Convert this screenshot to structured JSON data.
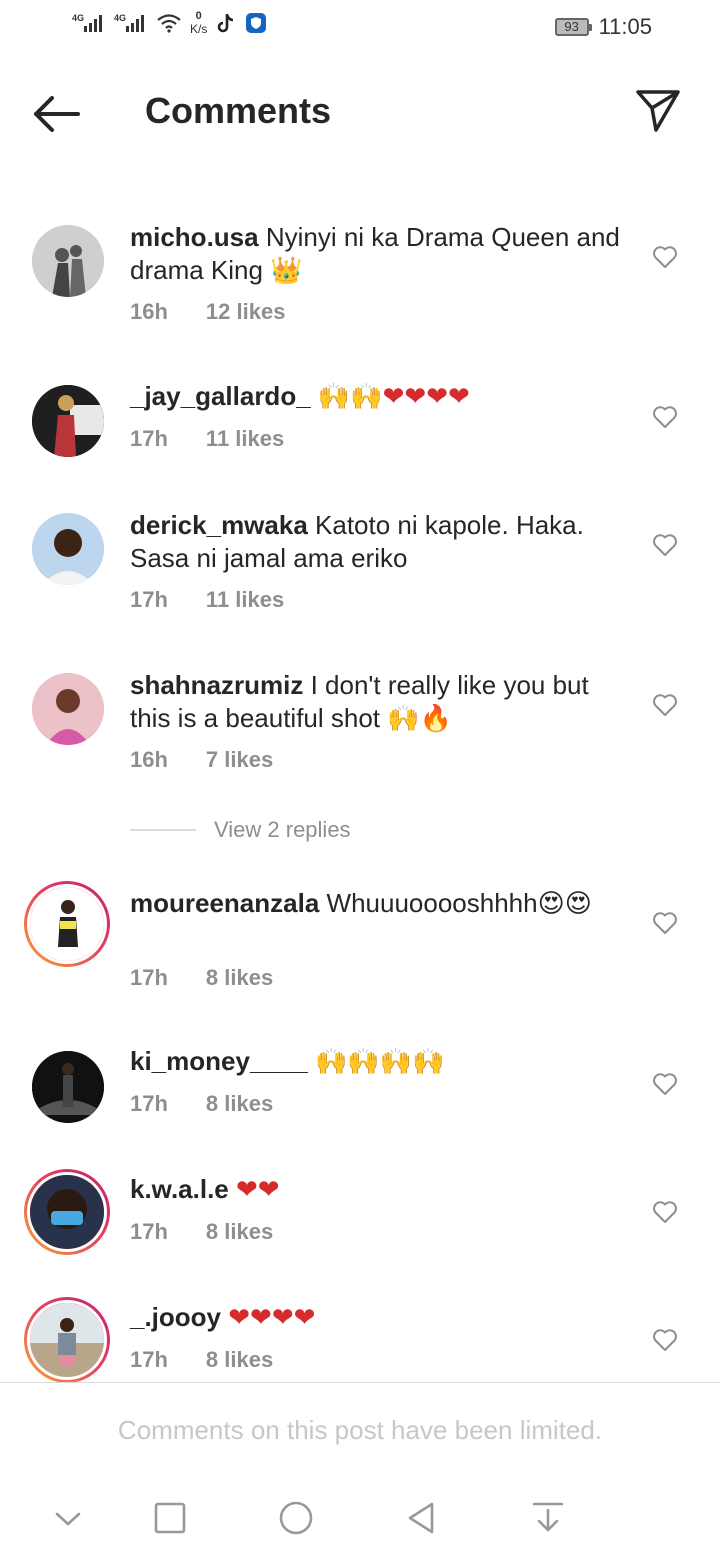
{
  "status_bar": {
    "net1": "4G",
    "net2": "4G",
    "speed_value": "0",
    "speed_unit": "K/s",
    "battery": "93",
    "time": "11:05"
  },
  "header": {
    "title": "Comments"
  },
  "comments": [
    {
      "user": "micho.usa",
      "text": "Nyinyi ni ka Drama Queen and drama King 👑",
      "time": "16h",
      "likes": "12 likes"
    },
    {
      "user": "_jay_gallardo_",
      "text": "🙌🙌❤❤❤❤",
      "time": "17h",
      "likes": "11 likes"
    },
    {
      "user": "derick_mwaka",
      "text": "Katoto ni kapole.  Haka. Sasa ni jamal ama eriko",
      "time": "17h",
      "likes": "11 likes"
    },
    {
      "user": "shahnazrumiz",
      "text": "I don't really like you but this is a beautiful shot 🙌🔥",
      "time": "16h",
      "likes": "7 likes"
    },
    {
      "user": "moureenanzala",
      "text": "Whuuuooooshhhh😍😍",
      "time": "17h",
      "likes": "8 likes"
    },
    {
      "user": "ki_money____",
      "text": "🙌🙌🙌🙌",
      "time": "17h",
      "likes": "8 likes"
    },
    {
      "user": "k.w.a.l.e",
      "text": "❤❤",
      "time": "17h",
      "likes": "8 likes"
    },
    {
      "user": "_.joooy",
      "text": "❤❤❤❤",
      "time": "17h",
      "likes": "8 likes"
    }
  ],
  "view_replies": "View 2 replies",
  "footer": {
    "limited_text": "Comments on this post have been limited."
  },
  "icons": {
    "back": "back-arrow-icon",
    "send": "send-icon",
    "heart": "heart-outline-icon",
    "nav": [
      "chevron-down-icon",
      "square-icon",
      "circle-icon",
      "triangle-back-icon",
      "download-icon"
    ]
  },
  "colors": {
    "text": "#262626",
    "secondary": "#8e8e8e",
    "story_ring": "#e8435f"
  }
}
